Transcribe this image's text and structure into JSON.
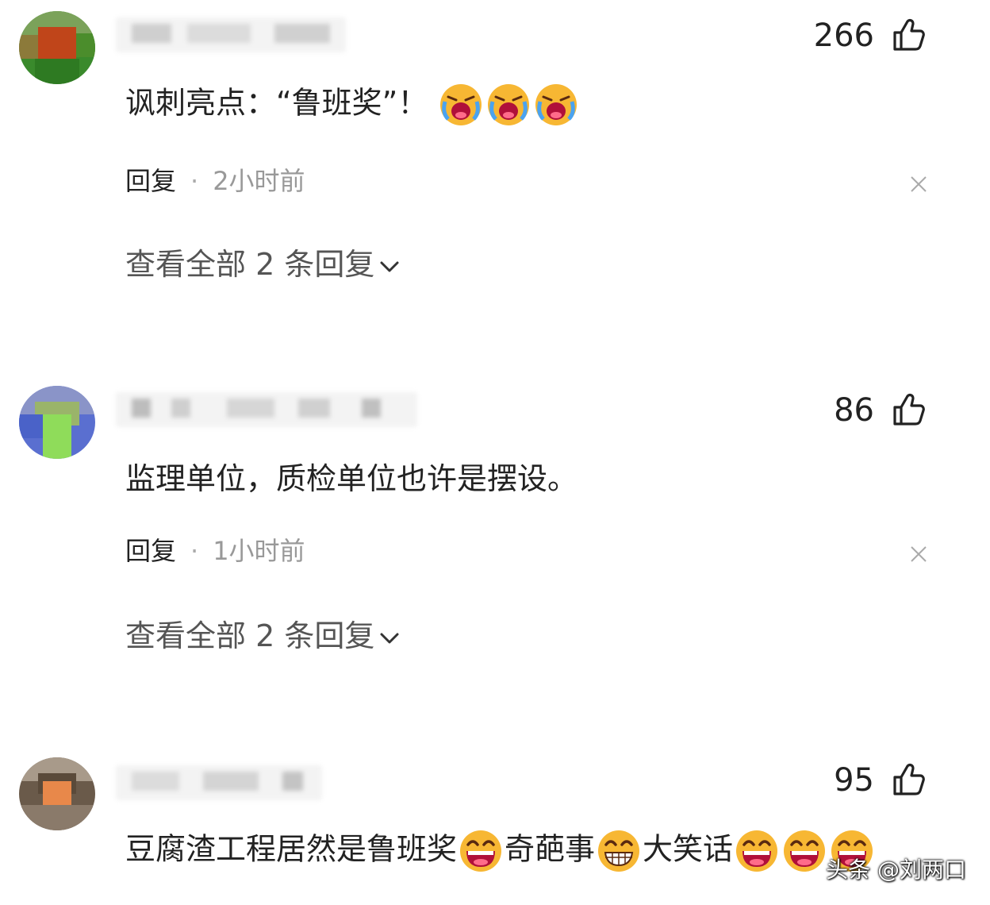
{
  "comments": [
    {
      "likes": "266",
      "text": "讽刺亮点：“鲁班奖”！",
      "reply_label": "回复",
      "separator": "·",
      "time": "2小时前",
      "view_replies": "查看全部 2 条回复"
    },
    {
      "likes": "86",
      "text": "监理单位，质检单位也许是摆设。",
      "reply_label": "回复",
      "separator": "·",
      "time": "1小时前",
      "view_replies": "查看全部 2 条回复"
    },
    {
      "likes": "95",
      "text_part1": "豆腐渣工程居然是鲁班奖",
      "text_part2": "奇葩事",
      "text_part3": "大笑话"
    }
  ],
  "icons": {
    "like": "thumbs-up-icon",
    "close": "close-icon",
    "expand": "chevron-down-icon",
    "emoji_cry": "crying-face-emoji",
    "emoji_laugh": "laughing-face-emoji",
    "emoji_grin": "grinning-face-emoji"
  },
  "watermark": "头条 @刘两口"
}
